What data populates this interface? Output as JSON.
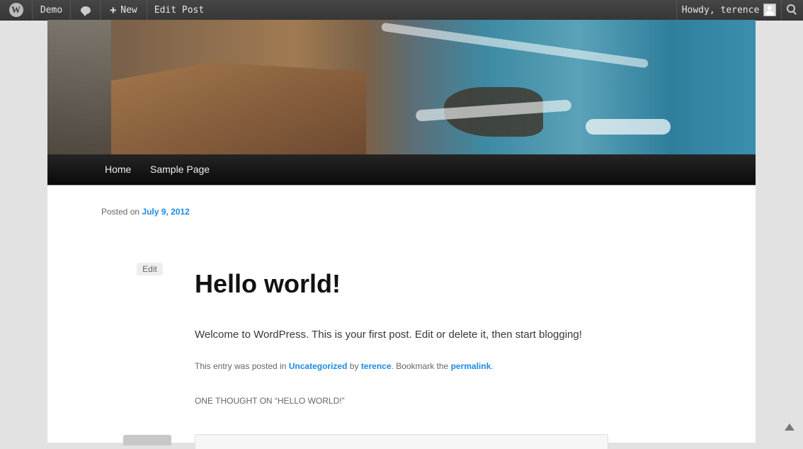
{
  "adminbar": {
    "wp_logo_icon": "wordpress-logo-icon",
    "site_name": "Demo",
    "comments_icon": "comment-bubble-icon",
    "new_label": "New",
    "edit_post_label": "Edit Post",
    "howdy_label": "Howdy, terence",
    "search_icon": "search-icon"
  },
  "nav": {
    "items": [
      "Home",
      "Sample Page"
    ]
  },
  "post": {
    "posted_on_label": "Posted on",
    "date": "July 9, 2012",
    "edit_label": "Edit",
    "title": "Hello world!",
    "content": "Welcome to WordPress. This is your first post. Edit or delete it, then start blogging!",
    "footer": {
      "prefix": "This entry was posted in",
      "category": "Uncategorized",
      "by": "by",
      "author": "terence",
      "bookmark": ". Bookmark the",
      "permalink": "permalink",
      "end": "."
    }
  },
  "comments": {
    "title": "ONE THOUGHT ON “HELLO WORLD!”"
  },
  "colors": {
    "link": "#1b8be0",
    "adminbar_bg": "#464646",
    "nav_bg": "#222222"
  }
}
